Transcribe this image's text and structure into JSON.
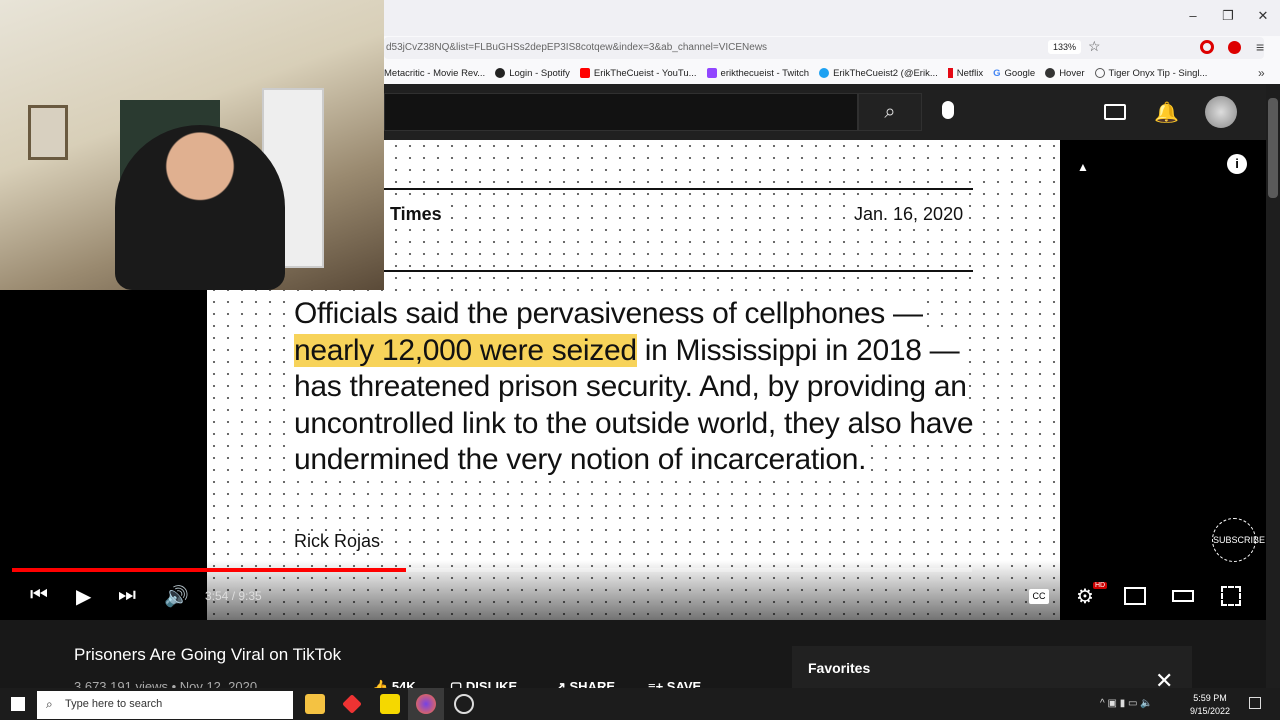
{
  "browser": {
    "url": "d53jCvZ38NQ&list=FLBuGHSs2depEP3IS8cotqew&index=3&ab_channel=VICENews",
    "zoom": "133%",
    "window_controls": [
      "–",
      "❐",
      "✕"
    ],
    "bookmarks": [
      {
        "label": "Metacritic - Movie Rev...",
        "color": "#333"
      },
      {
        "label": "Login - Spotify",
        "color": "#222"
      },
      {
        "label": "ErikTheCueist - YouTu...",
        "color": "#f00"
      },
      {
        "label": "erikthecueist - Twitch",
        "color": "#9146ff"
      },
      {
        "label": "ErikTheCueist2 (@Erik...",
        "color": "#1da1f2"
      },
      {
        "label": "Netflix",
        "color": "#e50914"
      },
      {
        "label": "Google",
        "color": "#4285f4"
      },
      {
        "label": "Hover",
        "color": "#333"
      },
      {
        "label": "Tiger Onyx Tip - Singl...",
        "color": "#666"
      }
    ],
    "overflow": "»"
  },
  "video": {
    "source": "Times",
    "date": "Jan. 16, 2020",
    "quote_pre": "Officials said the pervasiveness of cellphones — ",
    "quote_highlight": "nearly 12,000 were seized",
    "quote_post": " in Mississippi in 2018 — has threatened prison security. And, by providing an uncontrolled link to the outside world, they also have undermined the very notion of incarceration.",
    "author": "Rick Rojas",
    "time": "3:54 / 9:35",
    "progress": 0.41,
    "subscribe": "SUBSCRIBE",
    "hd_badge": "HD"
  },
  "page": {
    "title": "Prisoners Are Going Viral on TikTok",
    "views": "3,673,191 views • Nov 12, 2020",
    "likes": "54K",
    "dislike": "DISLIKE",
    "share": "SHARE",
    "save": "SAVE",
    "more": "...",
    "favorites": "Favorites"
  },
  "taskbar": {
    "search_placeholder": "Type here to search",
    "time": "5:59 PM",
    "date": "9/15/2022"
  },
  "colors": {
    "progress": "#ff0000",
    "highlight": "#f7d35a"
  }
}
